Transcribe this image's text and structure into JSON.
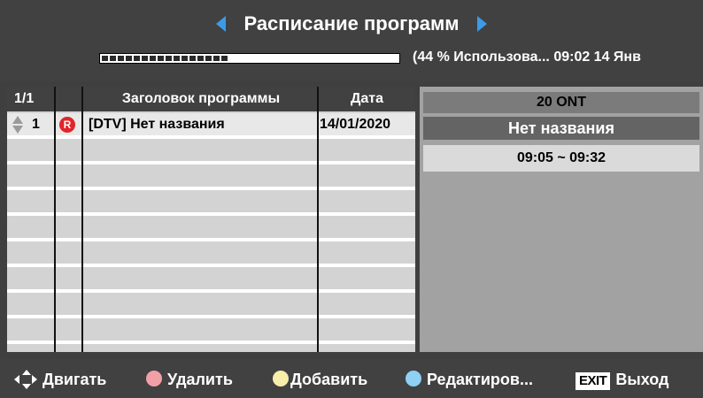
{
  "header": {
    "title": "Расписание программ",
    "usage_percent": 44,
    "usage_text": "(44 % Использова... 09:02  14 Янв"
  },
  "table": {
    "columns": [
      "1/1",
      "Заголовок программы",
      "Дата"
    ],
    "rows": [
      {
        "num": "1",
        "rec_icon_label": "R",
        "title": "[DTV] Нет названия",
        "date": "14/01/2020"
      }
    ]
  },
  "info": {
    "channel": "20 ONT",
    "program_name": "Нет названия",
    "time_range": "09:05 ~ 09:32"
  },
  "footer": {
    "move": "Двигать",
    "delete": "Удалить",
    "add": "Добавить",
    "edit": "Редактиров...",
    "exit_badge": "EXIT",
    "exit": "Выход"
  },
  "colors": {
    "accent_arrow": "#3c9be6",
    "delete_dot": "#f2a0a8",
    "add_dot": "#f7eeaa",
    "edit_dot": "#8fd0f4",
    "record_icon": "#e0252a"
  },
  "icons": [
    "arrow-left-icon",
    "arrow-right-icon",
    "record-icon",
    "up-down-icon",
    "move-icon"
  ]
}
